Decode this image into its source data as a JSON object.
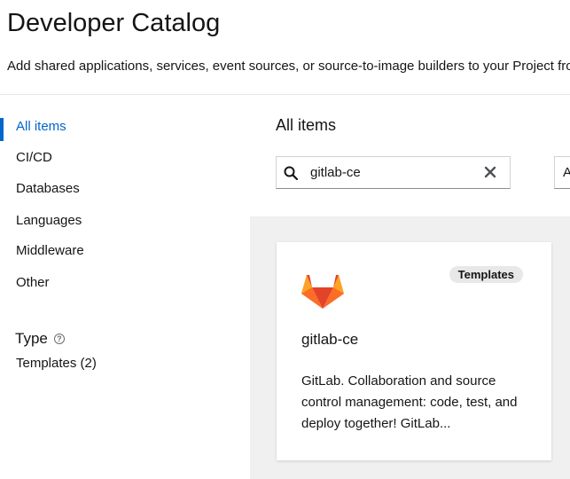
{
  "header": {
    "title": "Developer Catalog",
    "description": "Add shared applications, services, event sources, or source-to-image builders to your Project from the developer catalog."
  },
  "sidebar": {
    "categories": [
      {
        "label": "All items",
        "active": true
      },
      {
        "label": "CI/CD",
        "active": false
      },
      {
        "label": "Databases",
        "active": false
      },
      {
        "label": "Languages",
        "active": false
      },
      {
        "label": "Middleware",
        "active": false
      },
      {
        "label": "Other",
        "active": false
      }
    ],
    "type_filter": {
      "heading": "Type",
      "help_icon": "question-circle-icon",
      "options": [
        {
          "label": "Templates (2)"
        }
      ]
    }
  },
  "main": {
    "section_title": "All items",
    "search": {
      "value": "gitlab-ce",
      "icon": "search-icon",
      "clear_icon": "close-icon"
    },
    "sort": {
      "value": "A"
    },
    "cards": [
      {
        "icon": "gitlab-icon",
        "badge": "Templates",
        "title": "gitlab-ce",
        "description": "GitLab. Collaboration and source control management: code, test, and deploy together! GitLab..."
      }
    ]
  },
  "colors": {
    "accent": "#0066cc",
    "gallery_bg": "#f0f0f0",
    "badge_bg": "#e8e8e8",
    "gitlab_orange": "#fc6d26",
    "gitlab_red": "#e24329",
    "gitlab_light": "#fca326"
  }
}
